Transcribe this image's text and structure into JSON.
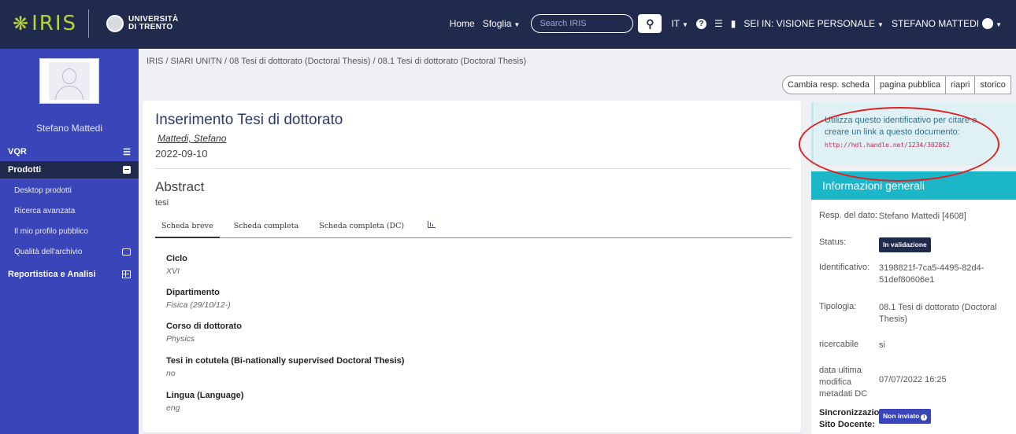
{
  "brand": {
    "name": "IRIS",
    "university_line1": "UNIVERSITÀ",
    "university_line2": "DI TRENTO"
  },
  "topnav": {
    "home": "Home",
    "browse": "Sfoglia",
    "search_placeholder": "Search IRIS",
    "language": "IT",
    "view_mode": "SEI IN: VISIONE PERSONALE",
    "user": "STEFANO MATTEDI"
  },
  "sidebar": {
    "user_name": "Stefano Mattedi",
    "sections": [
      {
        "label": "VQR"
      },
      {
        "label": "Prodotti"
      },
      {
        "label": "Reportistica e Analisi"
      }
    ],
    "sub_items": [
      {
        "label": "Desktop prodotti"
      },
      {
        "label": "Ricerca avanzata"
      },
      {
        "label": "Il mio profilo pubblico"
      },
      {
        "label": "Qualità dell'archivio"
      }
    ]
  },
  "breadcrumb": "IRIS  /  SIARI UNITN  /  08 Tesi di dottorato (Doctoral Thesis)  /  08.1 Tesi di dottorato (Doctoral Thesis)",
  "actions": [
    "Cambia resp. scheda",
    "pagina pubblica",
    "riapri",
    "storico"
  ],
  "record": {
    "title": "Inserimento Tesi di dottorato",
    "author": "Mattedi, Stefano",
    "date": "2022-09-10",
    "abstract_heading": "Abstract",
    "abstract_text": "tesi",
    "tabs": [
      "Scheda breve",
      "Scheda completa",
      "Scheda completa (DC)"
    ],
    "fields": [
      {
        "label": "Ciclo",
        "value": "XVI"
      },
      {
        "label": "Dipartimento",
        "value": "Fisica (29/10/12-)"
      },
      {
        "label": "Corso di dottorato",
        "value": "Physics"
      },
      {
        "label": "Tesi in cotutela (Bi-nationally supervised Doctoral Thesis)",
        "value": "no"
      },
      {
        "label": "Lingua (Language)",
        "value": "eng"
      }
    ]
  },
  "cite": {
    "text": "Utilizza questo identificativo per citare o creare un link a questo documento:",
    "link": "http://hdl.handle.net/1234/302862"
  },
  "info": {
    "heading": "Informazioni generali",
    "rows": [
      {
        "key": "Resp. del dato:",
        "value": "Stefano Mattedi [4608]"
      },
      {
        "key": "Status:",
        "value": "In validazione"
      },
      {
        "key": "Identificativo:",
        "value": "3198821f-7ca5-4495-82d4-51def80606e1"
      },
      {
        "key": "Tipologia:",
        "value": "08.1 Tesi di dottorato (Doctoral Thesis)"
      },
      {
        "key": "ricercabile",
        "value": "si"
      },
      {
        "key": "data ultima modifica metadati DC",
        "value": "07/07/2022 16:25"
      },
      {
        "key": "Sincronizzazione Sito Docente:",
        "value": "Non inviato"
      }
    ]
  },
  "colors": {
    "navbar": "#1f2a4d",
    "sidebar": "#3945b8",
    "accent_teal": "#1bb6c7",
    "annotation": "#e02020"
  }
}
